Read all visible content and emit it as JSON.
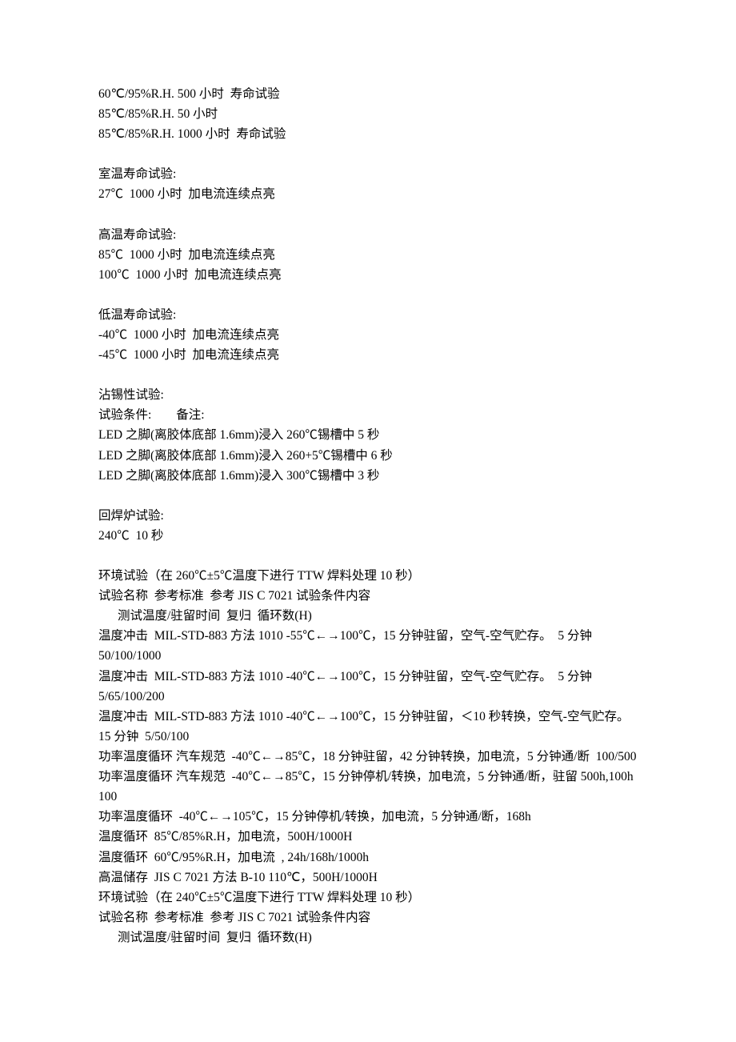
{
  "lines": [
    {
      "text": "60℃/95%R.H. 500 小时  寿命试验"
    },
    {
      "text": "85℃/85%R.H. 50 小时"
    },
    {
      "text": "85℃/85%R.H. 1000 小时  寿命试验"
    },
    {
      "blank": true
    },
    {
      "text": "室温寿命试验:"
    },
    {
      "text": "27℃  1000 小时  加电流连续点亮"
    },
    {
      "blank": true
    },
    {
      "text": "高温寿命试验:"
    },
    {
      "text": "85℃  1000 小时  加电流连续点亮"
    },
    {
      "text": "100℃  1000 小时  加电流连续点亮"
    },
    {
      "blank": true
    },
    {
      "text": "低温寿命试验:"
    },
    {
      "text": "-40℃  1000 小时  加电流连续点亮"
    },
    {
      "text": "-45℃  1000 小时  加电流连续点亮"
    },
    {
      "blank": true
    },
    {
      "text": "沾锡性试验:"
    },
    {
      "text": "试验条件:        备注:"
    },
    {
      "text": "LED 之脚(离胶体底部 1.6mm)浸入 260℃锡槽中 5 秒"
    },
    {
      "text": "LED 之脚(离胶体底部 1.6mm)浸入 260+5℃锡槽中 6 秒"
    },
    {
      "text": "LED 之脚(离胶体底部 1.6mm)浸入 300℃锡槽中 3 秒"
    },
    {
      "blank": true
    },
    {
      "text": "回焊炉试验:"
    },
    {
      "text": "240℃  10 秒"
    },
    {
      "blank": true
    },
    {
      "text": "环境试验（在 260℃±5℃温度下进行 TTW 焊料处理 10 秒）"
    },
    {
      "text": "试验名称  参考标准  参考 JIS C 7021 试验条件内容"
    },
    {
      "text": "测试温度/驻留时间  复归  循环数(H)",
      "indent": true
    },
    {
      "text": "温度冲击  MIL-STD-883 方法 1010 -55℃←→100℃，15 分钟驻留，空气-空气贮存。  5 分钟  50/100/1000"
    },
    {
      "text": "温度冲击  MIL-STD-883 方法 1010 -40℃←→100℃，15 分钟驻留，空气-空气贮存。  5 分钟  5/65/100/200"
    },
    {
      "text": "温度冲击  MIL-STD-883 方法 1010 -40℃←→100℃，15 分钟驻留，＜10 秒转换，空气-空气贮存。  15 分钟  5/50/100"
    },
    {
      "text": "功率温度循环 汽车规范  -40℃←→85℃，18 分钟驻留，42 分钟转换，加电流，5 分钟通/断  100/500"
    },
    {
      "text": "功率温度循环 汽车规范  -40℃←→85℃，15 分钟停机/转换，加电流，5 分钟通/断，驻留 500h,100h  100"
    },
    {
      "text": "功率温度循环  -40℃←→105℃，15 分钟停机/转换，加电流，5 分钟通/断，168h"
    },
    {
      "text": "温度循环  85℃/85%R.H，加电流，500H/1000H"
    },
    {
      "text": "温度循环  60℃/95%R.H，加电流  , 24h/168h/1000h"
    },
    {
      "text": "高温储存  JIS C 7021 方法 B-10 110℃，500H/1000H"
    },
    {
      "text": "环境试验（在 240℃±5℃温度下进行 TTW 焊料处理 10 秒）"
    },
    {
      "text": "试验名称  参考标准  参考 JIS C 7021 试验条件内容"
    },
    {
      "text": "测试温度/驻留时间  复归  循环数(H)",
      "indent": true
    }
  ]
}
